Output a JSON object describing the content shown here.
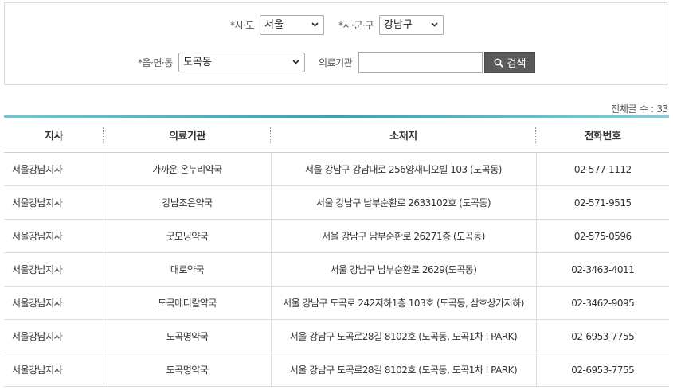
{
  "search": {
    "sido_label": "*시·도",
    "sido_value": "서울",
    "sigungu_label": "*시·군·구",
    "sigungu_value": "강남구",
    "emd_label": "*읍·면·동",
    "emd_value": "도곡동",
    "org_label": "의료기관",
    "org_value": "",
    "search_button": "검색"
  },
  "total": "전체글 수 : 33",
  "table": {
    "headers": [
      "지사",
      "의료기관",
      "소재지",
      "전화번호"
    ],
    "rows": [
      [
        "서울강남지사",
        "가까운 온누리약국",
        "서울 강남구 강남대로 256양재디오빌 103 (도곡동)",
        "02-577-1112"
      ],
      [
        "서울강남지사",
        "강남조은약국",
        "서울 강남구 남부순환로 2633102호 (도곡동)",
        "02-571-9515"
      ],
      [
        "서울강남지사",
        "굿모닝약국",
        "서울 강남구 남부순환로 26271층 (도곡동)",
        "02-575-0596"
      ],
      [
        "서울강남지사",
        "대로약국",
        "서울 강남구 남부순환로 2629(도곡동)",
        "02-3463-4011"
      ],
      [
        "서울강남지사",
        "도곡메디칼약국",
        "서울 강남구 도곡로 242지하1층 103호 (도곡동, 삼호상가지하)",
        "02-3462-9095"
      ],
      [
        "서울강남지사",
        "도곡명약국",
        "서울 강남구 도곡로28길 8102호 (도곡동, 도곡1차 I PARK)",
        "02-6953-7755"
      ],
      [
        "서울강남지사",
        "도곡명약국",
        "서울 강남구 도곡로28길 8102호 (도곡동, 도곡1차 I PARK)",
        "02-6953-7755"
      ]
    ]
  }
}
